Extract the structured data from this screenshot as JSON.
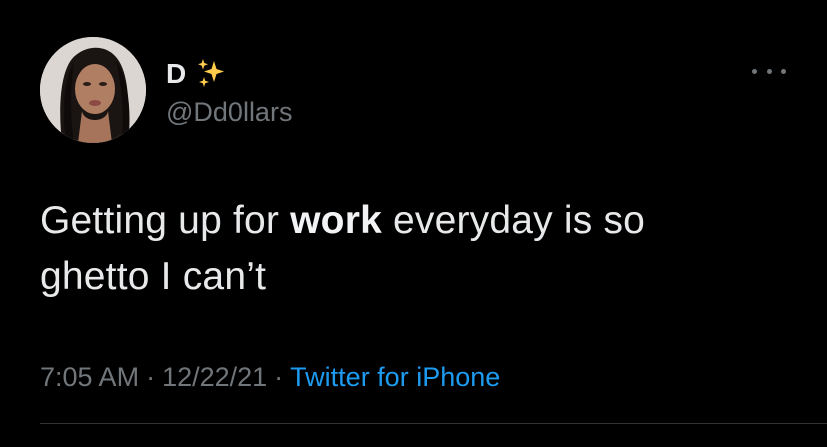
{
  "tweet": {
    "author": {
      "display_name": "D",
      "name_emoji_icon": "sparkles-icon",
      "handle": "@Dd0llars",
      "avatar_icon": "avatar-photo"
    },
    "more_icon": "more-options-icon",
    "text": {
      "part1": "Getting up for ",
      "bold": "work",
      "part2": " everyday is so",
      "line2": "ghetto I can’t"
    },
    "meta": {
      "time": "7:05 AM",
      "separator1": "·",
      "date": "12/22/21",
      "separator2": "·",
      "source": "Twitter for iPhone"
    }
  },
  "colors": {
    "background": "#000000",
    "text_primary": "#e7e9ea",
    "text_secondary": "#71767b",
    "link": "#1d9bf0",
    "sparkle": "#ffcc4d",
    "divider": "#2f3336"
  }
}
